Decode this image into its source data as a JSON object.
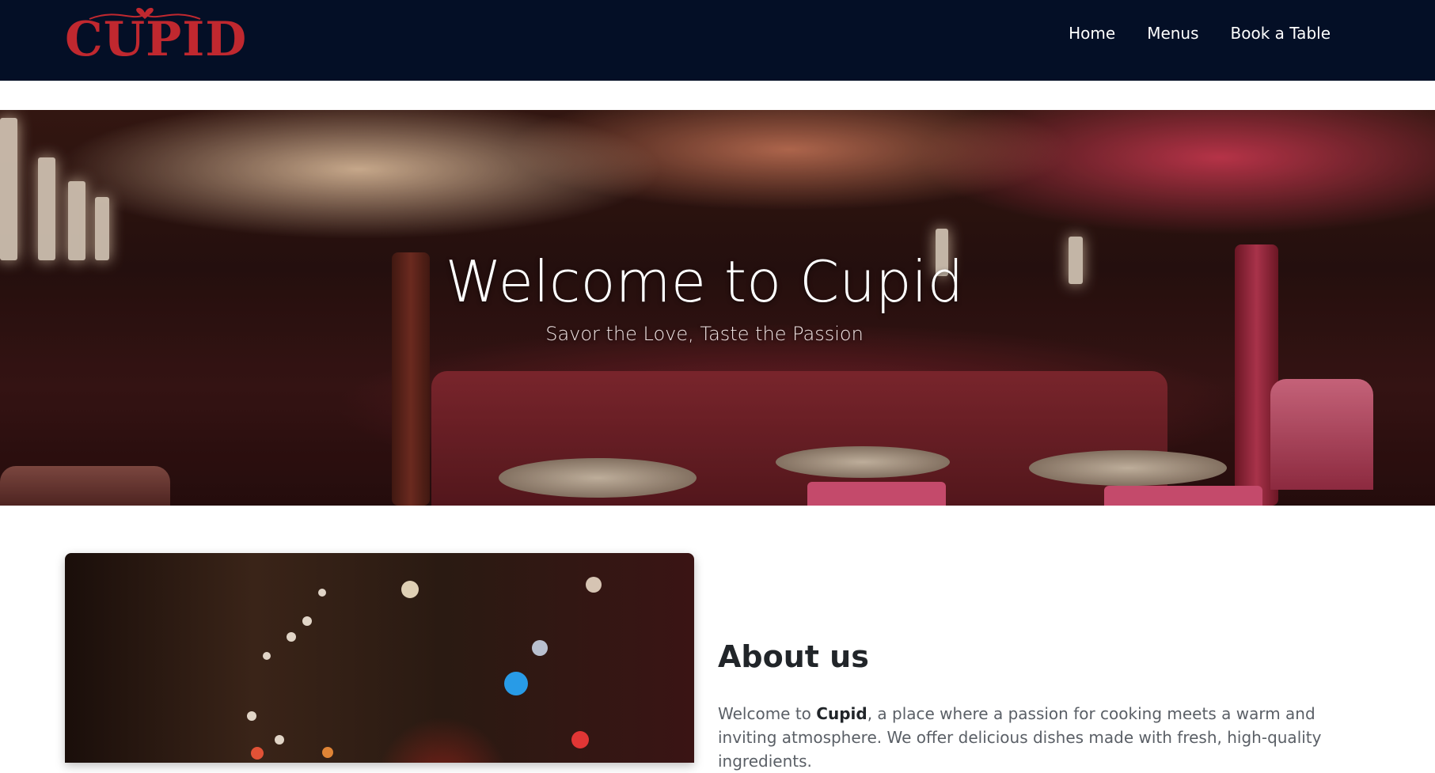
{
  "brand": {
    "name": "CUPID",
    "color": "#c0282f"
  },
  "nav": {
    "links": [
      {
        "label": "Home"
      },
      {
        "label": "Menus"
      },
      {
        "label": "Book a Table"
      }
    ]
  },
  "hero": {
    "title": "Welcome to Cupid",
    "subtitle": "Savor the Love, Taste the Passion"
  },
  "about": {
    "title": "About us",
    "text_before": "Welcome to ",
    "text_bold": "Cupid",
    "text_after": ", a place where a passion for cooking meets a warm and inviting atmosphere. We offer delicious dishes made with fresh, high-quality ingredients."
  },
  "colors": {
    "navbar_bg": "#040f26",
    "accent": "#c0282f"
  }
}
